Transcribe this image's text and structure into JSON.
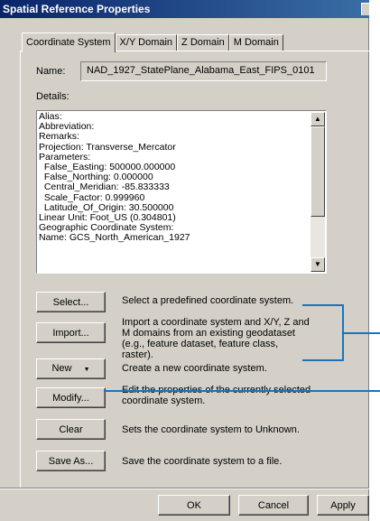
{
  "window": {
    "title": "Spatial Reference Properties"
  },
  "tabs": [
    {
      "label": "Coordinate System"
    },
    {
      "label": "X/Y Domain"
    },
    {
      "label": "Z Domain"
    },
    {
      "label": "M Domain"
    }
  ],
  "name_label": "Name:",
  "name_value": "NAD_1927_StatePlane_Alabama_East_FIPS_0101",
  "details_label": "Details:",
  "details_text": "Alias:\nAbbreviation:\nRemarks:\nProjection: Transverse_Mercator\nParameters:\n  False_Easting: 500000.000000\n  False_Northing: 0.000000\n  Central_Meridian: -85.833333\n  Scale_Factor: 0.999960\n  Latitude_Of_Origin: 30.500000\nLinear Unit: Foot_US (0.304801)\nGeographic Coordinate System:\nName: GCS_North_American_1927",
  "actions": [
    {
      "label": "Select...",
      "desc": "Select a predefined coordinate system."
    },
    {
      "label": "Import...",
      "desc": "Import a coordinate system and X/Y, Z and M domains from an existing geodataset (e.g., feature dataset, feature class, raster)."
    },
    {
      "label": "New",
      "desc": "Create a new coordinate system."
    },
    {
      "label": "Modify...",
      "desc": "Edit the properties of the currently selected coordinate system."
    },
    {
      "label": "Clear",
      "desc": "Sets the coordinate system to Unknown."
    },
    {
      "label": "Save As...",
      "desc": "Save the coordinate system to a file."
    }
  ],
  "footer": {
    "ok": "OK",
    "cancel": "Cancel",
    "apply": "Apply"
  },
  "colors": {
    "callout": "#1a74bd",
    "title_start": "#0a246a",
    "title_end": "#3a6ea5",
    "face": "#d4d0c8"
  },
  "icons": {
    "dropdown": "triangle-down-icon",
    "scroll_up": "triangle-up-icon",
    "scroll_down": "triangle-down-icon"
  }
}
